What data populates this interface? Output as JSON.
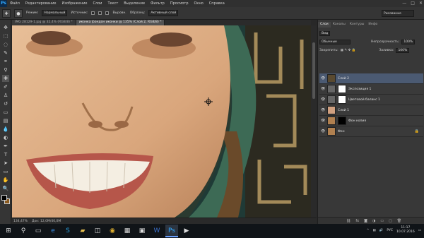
{
  "app": {
    "logo": "Ps"
  },
  "menu": [
    "Файл",
    "Редактирование",
    "Изображение",
    "Слои",
    "Текст",
    "Выделение",
    "Фильтр",
    "Просмотр",
    "Окно",
    "Справка"
  ],
  "window_controls": [
    "—",
    "□",
    "✕"
  ],
  "options": {
    "mode_label": "Режим:",
    "mode_value": "Нормальный",
    "opacity_label": "Источник:",
    "sample_label": "Образец:",
    "sample_value": "Активный слой",
    "check1": "Выровн.",
    "check2": "Образец",
    "workspace": "Рисование"
  },
  "tabs": [
    {
      "label": "IMG 28129-1.jpg @ 32,4% (RGB/8) *",
      "active": false
    },
    {
      "label": "иконка фондон иконки @ 135% (Слой 2, RGB/8) *",
      "active": true
    }
  ],
  "status": {
    "zoom": "134,47%",
    "doc": "Док: 12,0М/40,0М"
  },
  "panels": {
    "tabs": [
      "Слои",
      "Каналы",
      "Контуры",
      "Инфо"
    ],
    "kind_label": "Вид",
    "blend_mode": "Обычные",
    "opacity_label": "Непрозрачность:",
    "opacity_value": "100%",
    "lock_label": "Закрепить:",
    "fill_label": "Заливка:",
    "fill_value": "100%",
    "layers": [
      {
        "name": "Слой 2",
        "selected": true,
        "thumb": "#5a4a30",
        "mask": ""
      },
      {
        "name": "Экспозиция 1",
        "selected": false,
        "thumb": "#666",
        "mask": "#ffffff"
      },
      {
        "name": "Цветовой баланс 1",
        "selected": false,
        "thumb": "#666",
        "mask": "#ffffff"
      },
      {
        "name": "Слой 1",
        "selected": false,
        "thumb": "#d0a080",
        "mask": ""
      },
      {
        "name": "Фон копия",
        "selected": false,
        "thumb": "#b08050",
        "mask": "#000000"
      },
      {
        "name": "Фон",
        "selected": false,
        "thumb": "#b08050",
        "mask": "",
        "locked": true
      }
    ]
  },
  "taskbar": {
    "icons": [
      "windows-logo",
      "search",
      "task-view",
      "edge",
      "skype",
      "folder",
      "store",
      "chrome",
      "explorer",
      "apps",
      "word",
      "photoshop",
      "media"
    ],
    "tray": {
      "lang": "РУС",
      "time": "11:17",
      "date": "10.07.2016"
    }
  }
}
